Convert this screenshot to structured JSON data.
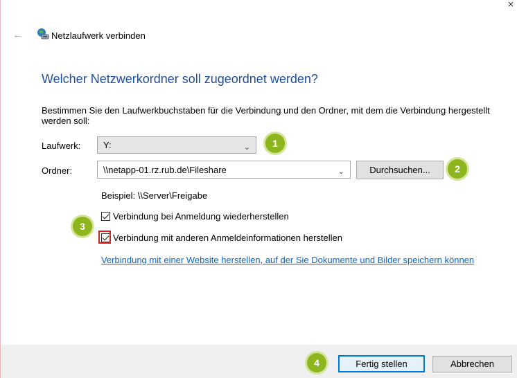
{
  "window": {
    "title": "Netzlaufwerk verbinden",
    "close_symbol": "×",
    "back_symbol": "←"
  },
  "heading": "Welcher Netzwerkordner soll zugeordnet werden?",
  "description": "Bestimmen Sie den Laufwerkbuchstaben für die Verbindung und den Ordner, mit dem die Verbindung hergestellt werden soll:",
  "drive": {
    "label": "Laufwerk:",
    "value": "Y:"
  },
  "folder": {
    "label": "Ordner:",
    "value": "\\\\netapp-01.rz.rub.de\\Fileshare",
    "browse_label": "Durchsuchen..."
  },
  "example": "Beispiel: \\\\Server\\Freigabe",
  "options": {
    "reconnect": {
      "label": "Verbindung bei Anmeldung wiederherstellen",
      "checked": true
    },
    "other_credentials": {
      "label": "Verbindung mit anderen Anmeldeinformationen herstellen",
      "checked": true
    }
  },
  "website_link": "Verbindung mit einer Website herstellen, auf der Sie Dokumente und Bilder speichern können",
  "footer": {
    "finish_label": "Fertig stellen",
    "cancel_label": "Abbrechen"
  },
  "badges": [
    "1",
    "2",
    "3",
    "4"
  ],
  "colors": {
    "accent": "#0078d7",
    "heading": "#1f4e9d",
    "link": "#0b67c2",
    "badge": "#8db51d",
    "highlight": "#e01e1e"
  },
  "icons": {
    "title": "network-drive-icon",
    "back": "back-arrow-icon",
    "close": "close-icon",
    "dropdown": "chevron-down-icon"
  }
}
